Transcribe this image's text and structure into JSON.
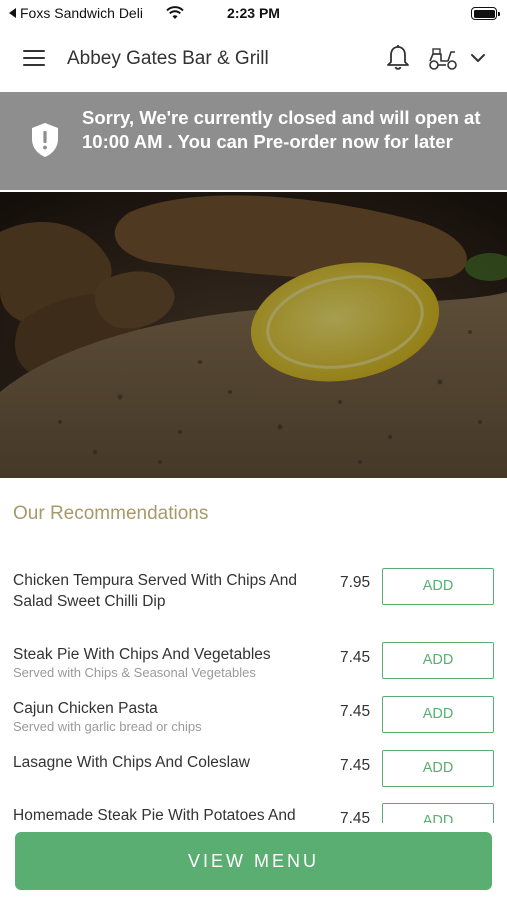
{
  "status_bar": {
    "back_label": "Foxs Sandwich Deli",
    "time": "2:23 PM"
  },
  "header": {
    "title": "Abbey Gates Bar & Grill"
  },
  "banner": {
    "message": "Sorry, We're currently closed and will open at 10:00 AM . You can Pre-order now for later"
  },
  "recommendations": {
    "heading": "Our Recommendations",
    "items": [
      {
        "name": "Chicken Tempura Served With Chips And Salad Sweet Chilli Dip",
        "description": "",
        "price": "7.95",
        "add_label": "ADD"
      },
      {
        "name": "Steak Pie With Chips And Vegetables",
        "description": "Served with Chips & Seasonal Vegetables",
        "price": "7.45",
        "add_label": "ADD"
      },
      {
        "name": "Cajun Chicken Pasta",
        "description": "Served with garlic bread or chips",
        "price": "7.45",
        "add_label": "ADD"
      },
      {
        "name": "Lasagne With Chips And Coleslaw",
        "description": "",
        "price": "7.45",
        "add_label": "ADD"
      },
      {
        "name": "Homemade Steak Pie With Potatoes And",
        "description": "",
        "price": "7.45",
        "add_label": "ADD"
      }
    ]
  },
  "view_menu_label": "VIEW MENU",
  "colors": {
    "accent_green": "#5aae72",
    "heading_gold": "#a8996b",
    "banner_gray": "#8e8e8e"
  }
}
